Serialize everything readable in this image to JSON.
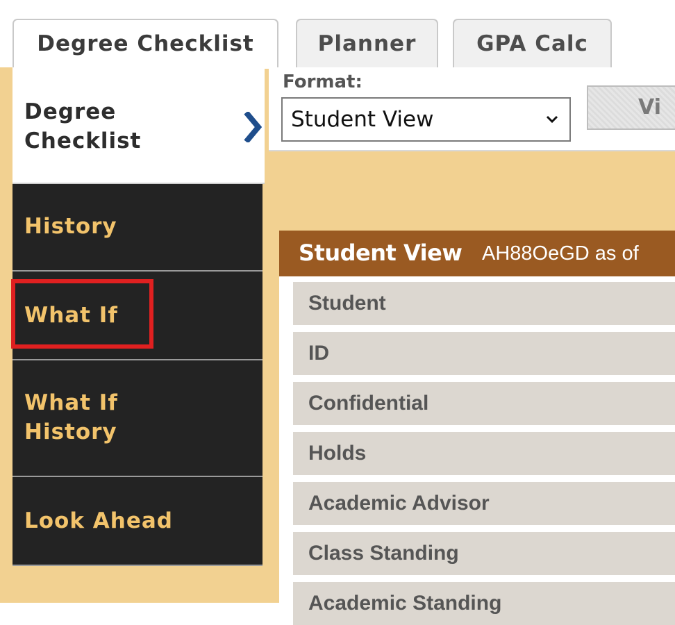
{
  "tabs": [
    {
      "label": "Degree Checklist",
      "active": true
    },
    {
      "label": "Planner",
      "active": false
    },
    {
      "label": "GPA Calc",
      "active": false
    }
  ],
  "sidebar": {
    "items": [
      {
        "label": "Degree\nChecklist",
        "active": true
      },
      {
        "label": "History"
      },
      {
        "label": "What If",
        "highlighted": true
      },
      {
        "label": "What If\nHistory"
      },
      {
        "label": "Look Ahead"
      }
    ],
    "active_indicator_icon": "chevron-right-icon"
  },
  "format": {
    "label": "Format:",
    "selected": "Student View",
    "view_button_label": "Vi"
  },
  "panel": {
    "title": "Student View",
    "subtitle": "AH88OeGD as of",
    "rows": [
      "Student",
      "ID",
      "Confidential",
      "Holds",
      "Academic Advisor",
      "Class Standing",
      "Academic Standing"
    ]
  },
  "colors": {
    "tan_background": "#f2d191",
    "sidebar_dark": "#232323",
    "sidebar_text": "#f2c36b",
    "panel_header": "#9a5a22",
    "row_background": "#dcd7d0",
    "highlight": "#e02020",
    "chevron": "#1f4e8c"
  }
}
